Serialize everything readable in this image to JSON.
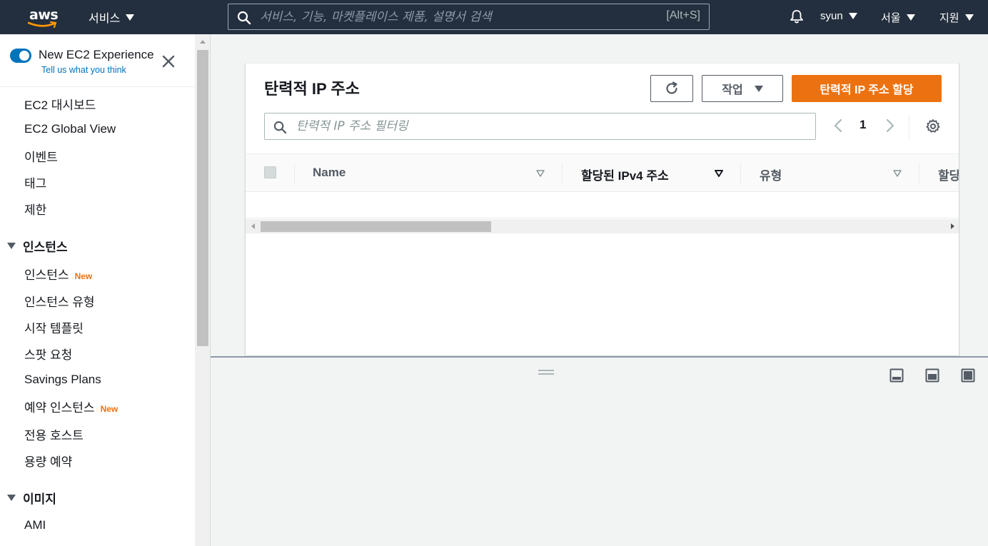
{
  "topnav": {
    "logo_text": "aws",
    "services_label": "서비스",
    "search_placeholder": "서비스, 기능, 마켓플레이스 제품, 설명서 검색",
    "search_shortcut": "[Alt+S]",
    "user_label": "syun",
    "region_label": "서울",
    "support_label": "지원"
  },
  "sidebar": {
    "toggle_title": "New EC2 Experience",
    "toggle_link": "Tell us what you think",
    "top_items": [
      {
        "label": "EC2 대시보드"
      },
      {
        "label": "EC2 Global View"
      },
      {
        "label": "이벤트"
      },
      {
        "label": "태그"
      },
      {
        "label": "제한"
      }
    ],
    "sections": [
      {
        "title": "인스턴스",
        "items": [
          {
            "label": "인스턴스",
            "badge": "New"
          },
          {
            "label": "인스턴스 유형"
          },
          {
            "label": "시작 템플릿"
          },
          {
            "label": "스팟 요청"
          },
          {
            "label": "Savings Plans"
          },
          {
            "label": "예약 인스턴스",
            "badge": "New"
          },
          {
            "label": "전용 호스트"
          },
          {
            "label": "용량 예약"
          }
        ]
      },
      {
        "title": "이미지",
        "items": [
          {
            "label": "AMI"
          }
        ]
      }
    ]
  },
  "main": {
    "title": "탄력적 IP 주소",
    "actions_label": "작업",
    "allocate_label": "탄력적 IP 주소 할당",
    "filter_placeholder": "탄력적 IP 주소 필터링",
    "page_number": "1",
    "columns": [
      {
        "label": "Name"
      },
      {
        "label": "할당된 IPv4 주소"
      },
      {
        "label": "유형"
      },
      {
        "label": "할당"
      }
    ]
  },
  "colors": {
    "nav_bg": "#232f3e",
    "primary": "#ec7211",
    "link": "#0073bb"
  },
  "icons": [
    "search-icon",
    "bell-icon",
    "close-icon",
    "refresh-icon",
    "chevron-left-icon",
    "chevron-right-icon",
    "gear-icon",
    "sort-icon"
  ]
}
